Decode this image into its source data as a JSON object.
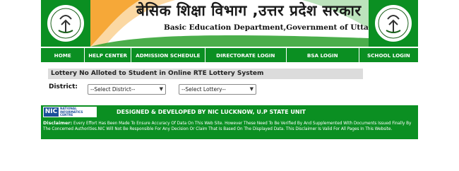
{
  "header": {
    "hindi_title": "बेसिक शिक्षा विभाग ,उत्तर प्रदेश सरकार",
    "english_title": "Basic Education Department,Government of Uttar Pradesh",
    "emblem_icon": "up-state-emblem-icon"
  },
  "nav": {
    "items": [
      {
        "label": "HOME"
      },
      {
        "label": "HELP CENTER"
      },
      {
        "label": "ADMISSION SCHEDULE"
      },
      {
        "label": "DIRECTORATE LOGIN"
      },
      {
        "label": "BSA LOGIN"
      },
      {
        "label": "SCHOOL LOGIN"
      }
    ]
  },
  "main": {
    "notice": "Lottery No Alloted to Student in Online RTE Lottery System",
    "district_label": "District:",
    "district_select": "--Select District--",
    "lottery_select": "--Select Lottery--"
  },
  "footer": {
    "nic_mark": "NIC",
    "nic_text": "NATIONAL INFORMATICS CENTRE",
    "designed": "DESIGNED & DEVELOPED BY NIC LUCKNOW, U.P STATE UNIT",
    "disclaimer_label": "Disclaimer:",
    "disclaimer_text": "Every Effort Has Been Made To Ensure Accuracy Of Data On This Web Site. However These Need To Be Verified By And Supplemented With Documents Issued Finally By The Concerned Authorities.NIC Will Not Be Responsible For Any Decision Or Claim That Is Based On The Displayed Data. This Disclaimer Is Valid For All Pages In This Website."
  },
  "colors": {
    "green": "#0b8f22",
    "saffron": "#f39a1e",
    "notice_bg": "#dcdcdc"
  }
}
